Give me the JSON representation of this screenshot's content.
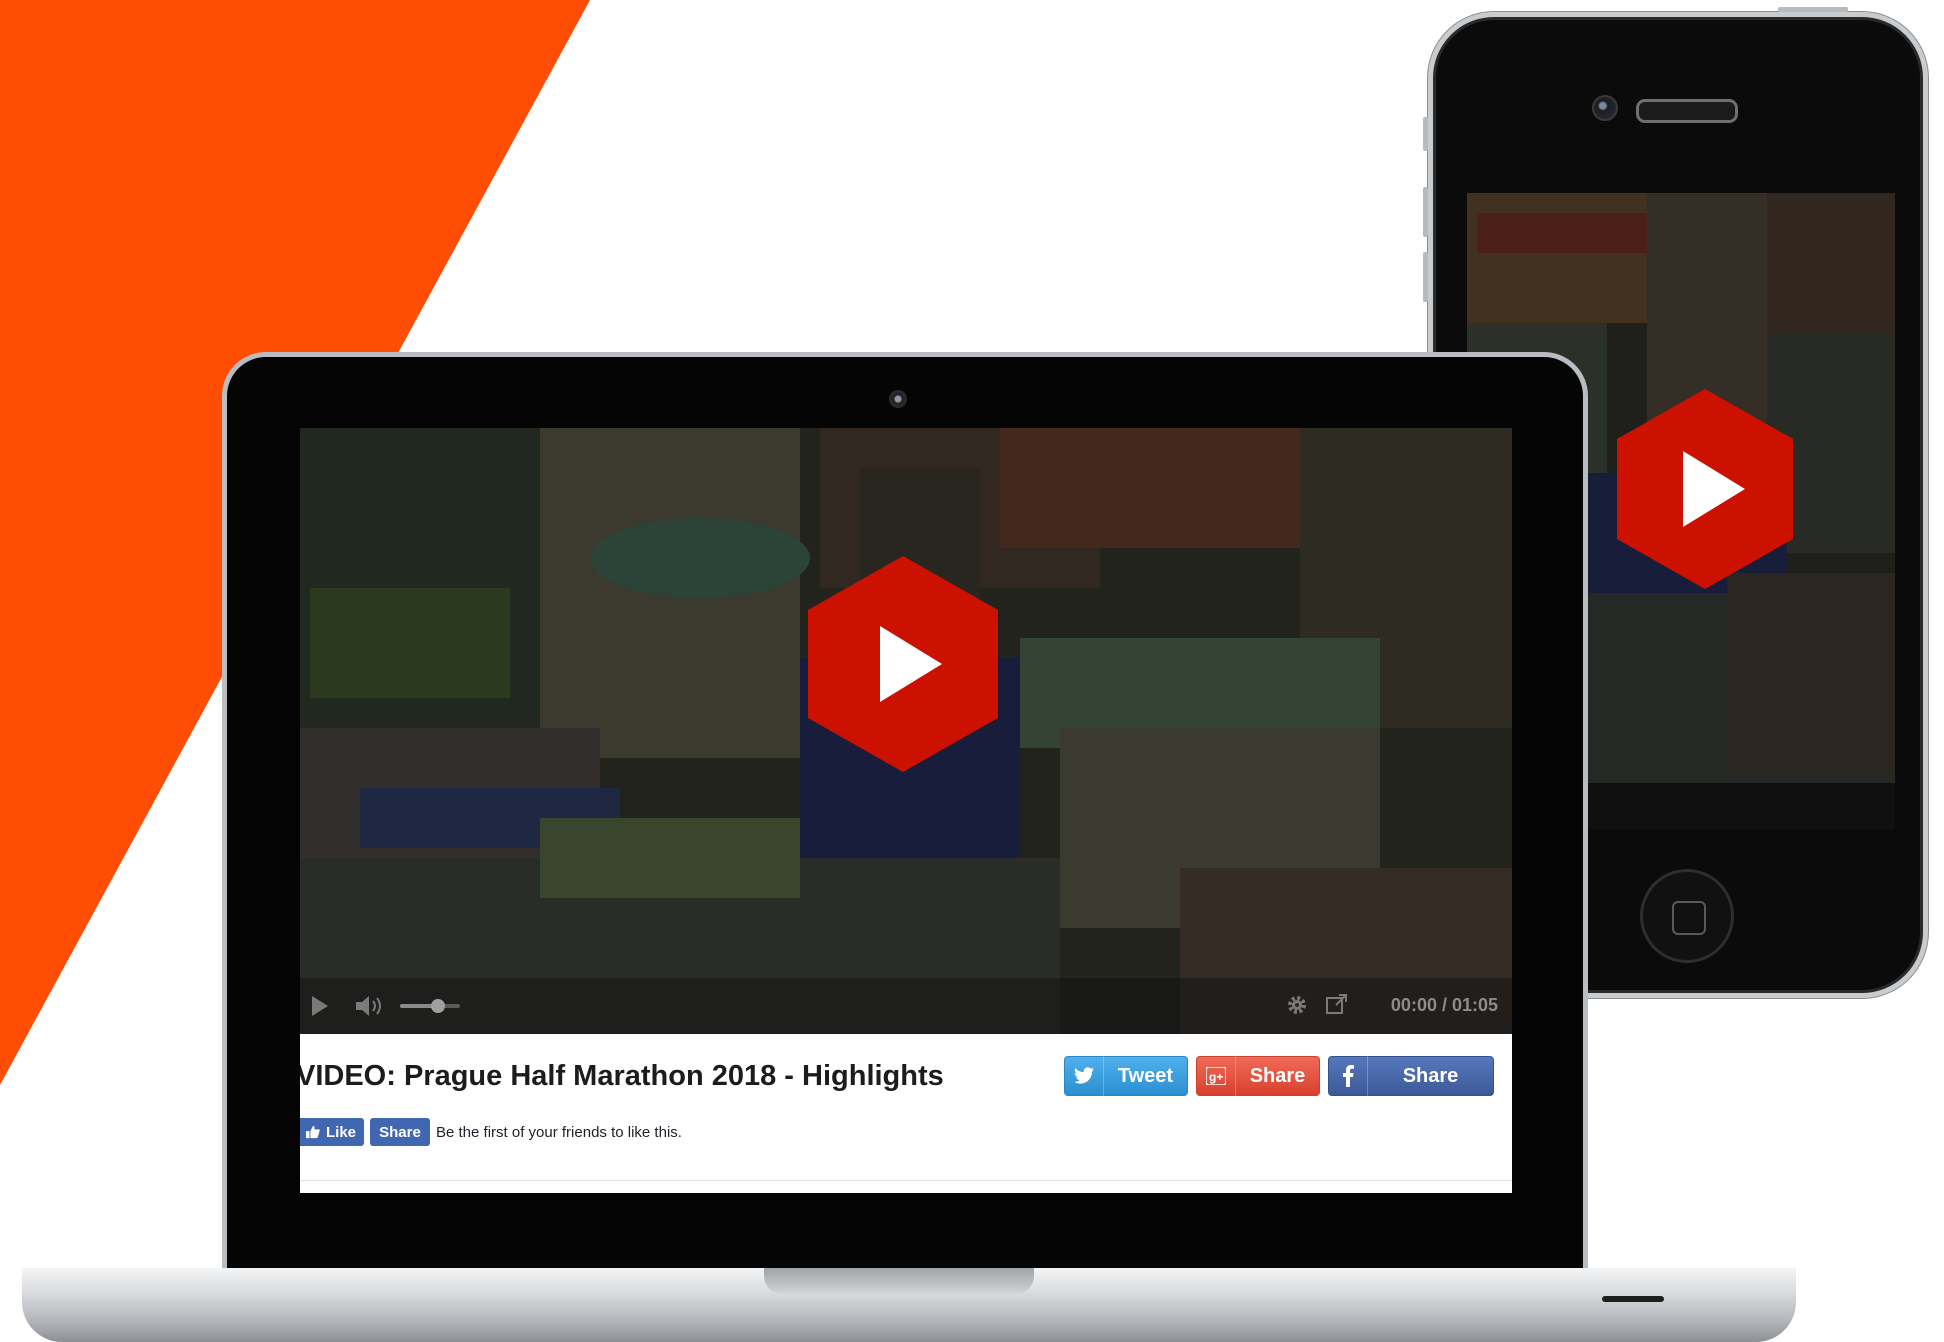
{
  "brand": {
    "accent": "#ff4d05",
    "play_red": "#d40f00"
  },
  "laptop_player": {
    "time_display": "00:00 / 01:05",
    "icons": [
      "play-icon",
      "volume-icon",
      "gear-icon",
      "popout-icon"
    ],
    "volume_level": 0.6
  },
  "video": {
    "title": "VIDEO: Prague Half Marathon 2018 - Highlights"
  },
  "share_buttons": {
    "tweet": "Tweet",
    "gplus": "Share",
    "facebook": "Share"
  },
  "facebook_widget": {
    "like": "Like",
    "share": "Share",
    "text": "Be the first of your friends to like this."
  }
}
